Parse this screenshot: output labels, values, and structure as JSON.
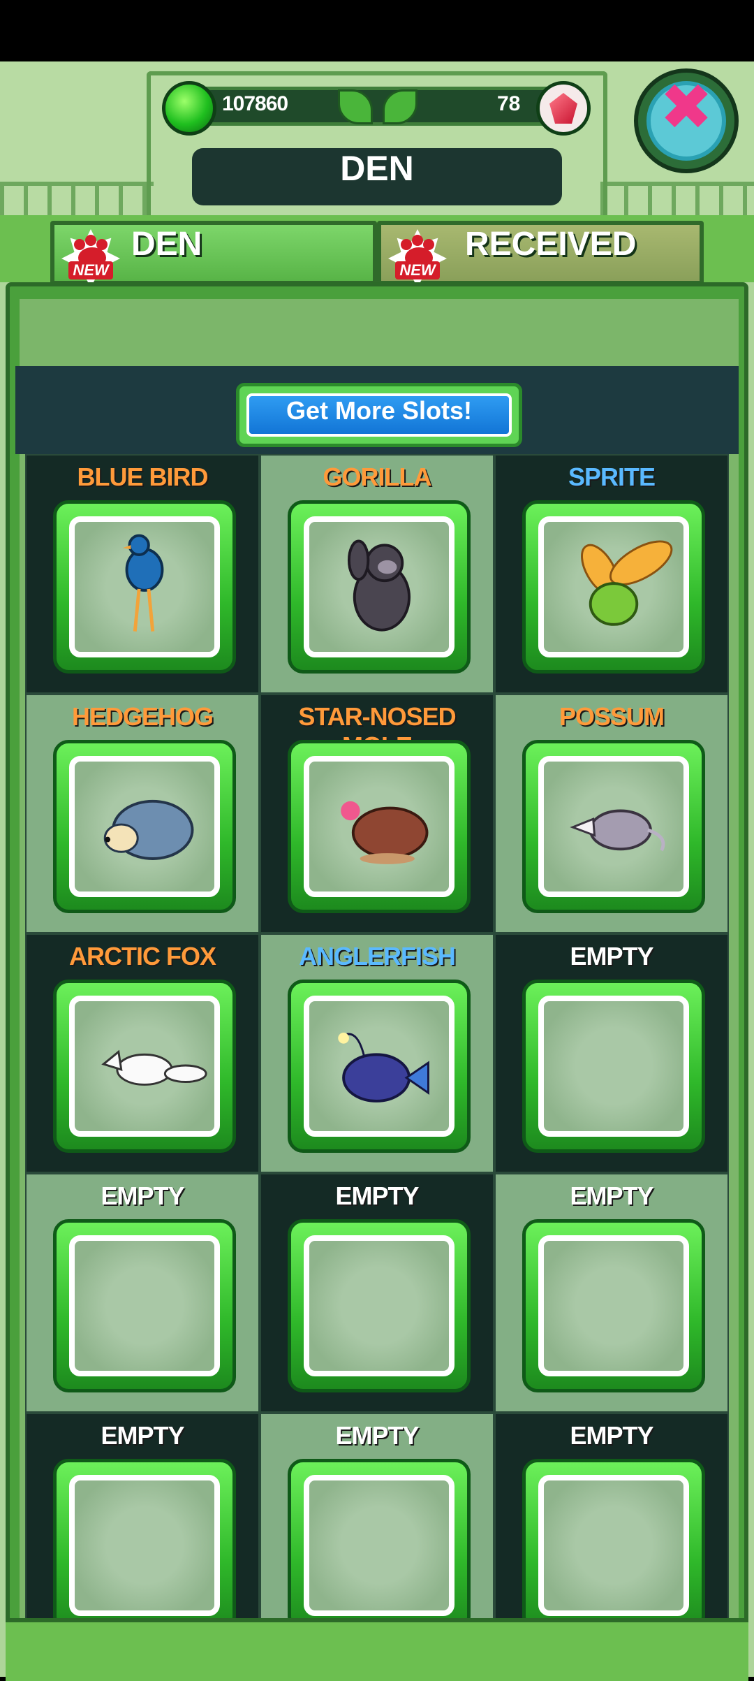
{
  "header": {
    "coins": "107860",
    "gems": "78",
    "title": "DEN",
    "close_icon": "close-x-icon"
  },
  "tabs": [
    {
      "label": "DEN",
      "badge": "NEW",
      "active": true
    },
    {
      "label": "RECEIVED",
      "badge": "NEW",
      "active": false
    }
  ],
  "more_slots_label": "Get More Slots!",
  "colors": {
    "orange": "#ff9a3a",
    "blue": "#5ab9ff",
    "white": "#ffffff"
  },
  "den": [
    {
      "name": "BLUE BIRD",
      "rarity_color": "#ff9a3a",
      "icon": "blue-bird-icon"
    },
    {
      "name": "GORILLA",
      "rarity_color": "#ff9a3a",
      "icon": "gorilla-icon"
    },
    {
      "name": "SPRITE",
      "rarity_color": "#5ab9ff",
      "icon": "sprite-icon"
    },
    {
      "name": "HEDGEHOG",
      "rarity_color": "#ff9a3a",
      "icon": "hedgehog-icon"
    },
    {
      "name": "STAR-NOSED MOLE",
      "rarity_color": "#ff9a3a",
      "icon": "star-nosed-mole-icon"
    },
    {
      "name": "POSSUM",
      "rarity_color": "#ff9a3a",
      "icon": "possum-icon"
    },
    {
      "name": "ARCTIC FOX",
      "rarity_color": "#ff9a3a",
      "icon": "arctic-fox-icon"
    },
    {
      "name": "ANGLERFISH",
      "rarity_color": "#5ab9ff",
      "icon": "anglerfish-icon"
    },
    {
      "name": "EMPTY",
      "rarity_color": "#ffffff",
      "icon": ""
    },
    {
      "name": "EMPTY",
      "rarity_color": "#ffffff",
      "icon": ""
    },
    {
      "name": "EMPTY",
      "rarity_color": "#ffffff",
      "icon": ""
    },
    {
      "name": "EMPTY",
      "rarity_color": "#ffffff",
      "icon": ""
    },
    {
      "name": "EMPTY",
      "rarity_color": "#ffffff",
      "icon": ""
    },
    {
      "name": "EMPTY",
      "rarity_color": "#ffffff",
      "icon": ""
    },
    {
      "name": "EMPTY",
      "rarity_color": "#ffffff",
      "icon": ""
    }
  ]
}
